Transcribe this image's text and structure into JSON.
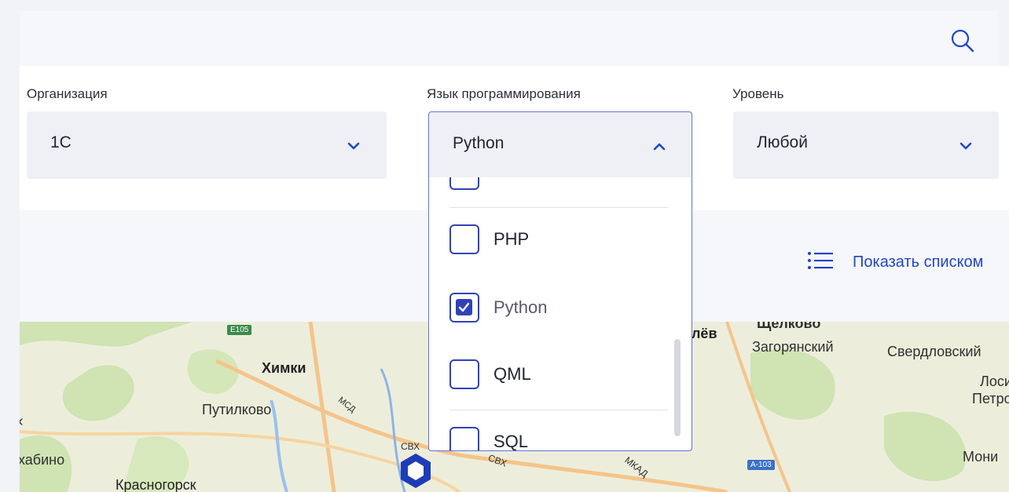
{
  "search": {
    "icon": "search-icon"
  },
  "filters": {
    "organization": {
      "label": "Организация",
      "value": "1С"
    },
    "language": {
      "label": "Язык программирования",
      "value": "Python"
    },
    "level": {
      "label": "Уровень",
      "value": "Любой"
    }
  },
  "dropdown": {
    "options": [
      {
        "label": "PHP",
        "checked": false
      },
      {
        "label": "Python",
        "checked": true
      },
      {
        "label": "QML",
        "checked": false
      },
      {
        "label": "SQL",
        "checked": false
      }
    ]
  },
  "list_toggle": {
    "label": "Показать списком"
  },
  "map": {
    "labels": [
      "Химки",
      "Путилково",
      "хабино",
      "Красногорск",
      "лёв",
      "Загорянский",
      "Свердловский",
      "Лоси",
      "Петров",
      "Мони",
      "Щелково"
    ],
    "roads": [
      "E105",
      "A-103",
      "МКАД",
      "СВХ",
      "МСД"
    ]
  },
  "colors": {
    "accent": "#2146c9",
    "checkbox": "#2f43b7",
    "focus_border": "#5f74d8"
  }
}
